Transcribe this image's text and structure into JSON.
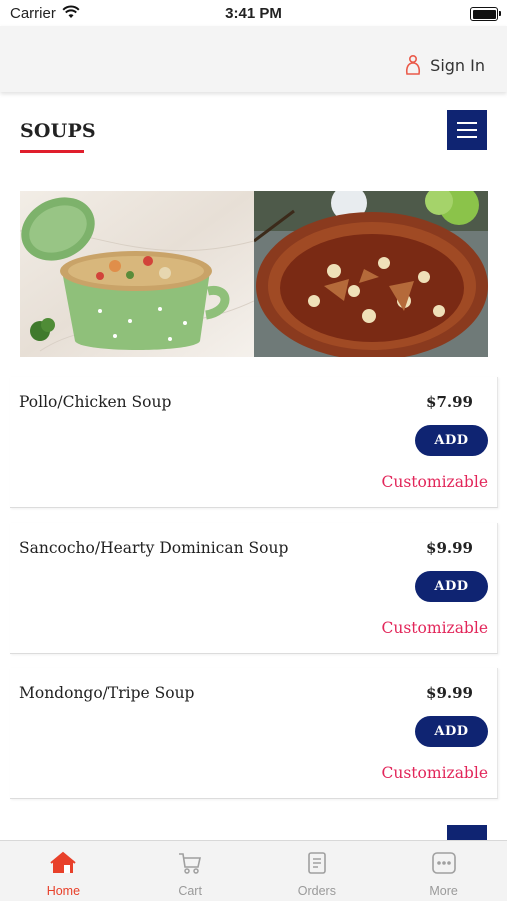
{
  "status_bar": {
    "carrier": "Carrier",
    "time": "3:41 PM"
  },
  "header": {
    "sign_in_label": "Sign In"
  },
  "section": {
    "title": "SOUPS",
    "accent_color": "#e01e2c"
  },
  "items": [
    {
      "name": "Pollo/Chicken Soup",
      "price": "$7.99",
      "add_label": "ADD",
      "note": "Customizable"
    },
    {
      "name": "Sancocho/Hearty Dominican Soup",
      "price": "$9.99",
      "add_label": "ADD",
      "note": "Customizable"
    },
    {
      "name": "Mondongo/Tripe Soup",
      "price": "$9.99",
      "add_label": "ADD",
      "note": "Customizable"
    }
  ],
  "tabs": [
    {
      "label": "Home",
      "icon": "home-icon",
      "active": true
    },
    {
      "label": "Cart",
      "icon": "cart-icon",
      "active": false
    },
    {
      "label": "Orders",
      "icon": "orders-icon",
      "active": false
    },
    {
      "label": "More",
      "icon": "more-icon",
      "active": false
    }
  ],
  "colors": {
    "primary": "#0f2472",
    "accent": "#e2265a",
    "active_tab": "#e8402a"
  }
}
